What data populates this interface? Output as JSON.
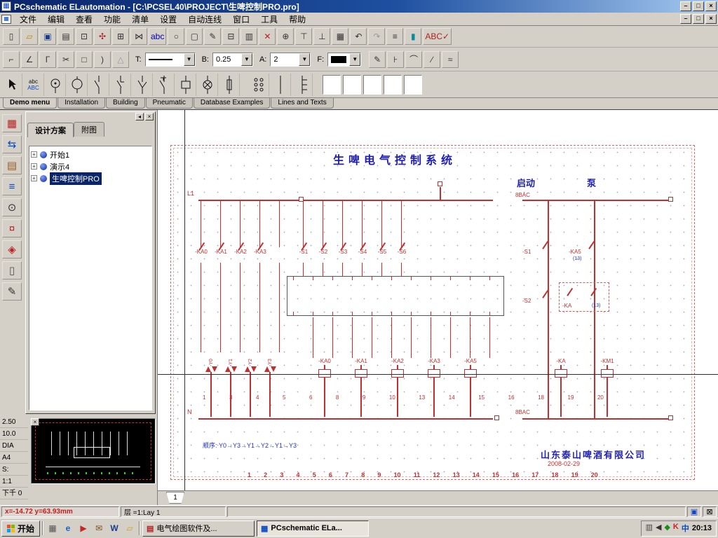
{
  "window": {
    "title": "PCschematic ELautomation - [C:\\PCSEL40\\PROJECT\\生啤控制PRO.pro]",
    "btn_min": "–",
    "btn_max": "□",
    "btn_close": "×"
  },
  "menu": {
    "items": [
      "文件",
      "编辑",
      "查看",
      "功能",
      "清单",
      "设置",
      "自动连线",
      "窗口",
      "工具",
      "帮助"
    ]
  },
  "toolbar_main": {
    "icons": [
      {
        "name": "new-icon",
        "glyph": "▯",
        "color": "#333333"
      },
      {
        "name": "open-icon",
        "glyph": "▱",
        "color": "#b8860b"
      },
      {
        "name": "save-icon",
        "glyph": "▣",
        "color": "#1a3a8a"
      },
      {
        "name": "print-icon",
        "glyph": "▤",
        "color": "#333333"
      },
      {
        "name": "print-preview-icon",
        "glyph": "⊡",
        "color": "#333333"
      },
      {
        "name": "object-groups-icon",
        "glyph": "✣",
        "color": "#b22222"
      },
      {
        "name": "pointer-grid-icon",
        "glyph": "⊞",
        "color": "#333333"
      },
      {
        "name": "symbols-icon",
        "glyph": "⋈",
        "color": "#333333"
      },
      {
        "name": "text-tool-icon",
        "glyph": "abc",
        "color": "#0000bb"
      },
      {
        "name": "circle-tool-icon",
        "glyph": "○",
        "color": "#333333"
      },
      {
        "name": "area-tool-icon",
        "glyph": "▢",
        "color": "#333333"
      },
      {
        "name": "pen-tool-icon",
        "glyph": "✎",
        "color": "#333333"
      },
      {
        "name": "paste-icon",
        "glyph": "⊟",
        "color": "#333333"
      },
      {
        "name": "copy-icon",
        "glyph": "▥",
        "color": "#333333"
      },
      {
        "name": "delete-icon",
        "glyph": "✕",
        "color": "#b22222"
      },
      {
        "name": "move-icon",
        "glyph": "⊕",
        "color": "#333333"
      },
      {
        "name": "reference-up-icon",
        "glyph": "⊤",
        "color": "#333333"
      },
      {
        "name": "reference-down-icon",
        "glyph": "⊥",
        "color": "#333333"
      },
      {
        "name": "net-grid-icon",
        "glyph": "▦",
        "color": "#333333"
      },
      {
        "name": "undo-icon",
        "glyph": "↶",
        "color": "#333333"
      },
      {
        "name": "redo-icon",
        "glyph": "↷",
        "color": "#999999"
      },
      {
        "name": "lists-icon",
        "glyph": "≡",
        "color": "#333333"
      },
      {
        "name": "manual-icon",
        "glyph": "▮",
        "color": "#0a8a9a"
      },
      {
        "name": "spellcheck-icon",
        "glyph": "ABC✓",
        "color": "#b22222"
      }
    ]
  },
  "toolbar_draw": {
    "left_icons": [
      {
        "name": "line-ortho-icon",
        "glyph": "⌐",
        "color": "#333333"
      },
      {
        "name": "line-angle-icon",
        "glyph": "∠",
        "color": "#333333"
      },
      {
        "name": "line-corner-icon",
        "glyph": "Γ",
        "color": "#333333"
      },
      {
        "name": "trim-icon",
        "glyph": "✂",
        "color": "#333333"
      },
      {
        "name": "rectangle-icon",
        "glyph": "□",
        "color": "#333333"
      },
      {
        "name": "arc-icon",
        "glyph": ")",
        "color": "#333333"
      },
      {
        "name": "ellipse-icon",
        "glyph": "△",
        "color": "#999999"
      }
    ],
    "t_label": "T:",
    "b_label": "B:",
    "b_value": "0.25",
    "a_label": "A:",
    "a_value": "2",
    "f_label": "F:",
    "right_icons": [
      {
        "name": "pen-icon",
        "glyph": "✎",
        "color": "#333333"
      },
      {
        "name": "junction-icon",
        "glyph": "⊦",
        "color": "#333333"
      },
      {
        "name": "arc-segment-icon",
        "glyph": "⌒",
        "color": "#333333"
      },
      {
        "name": "switch-line-icon",
        "glyph": "∕",
        "color": "#333333"
      },
      {
        "name": "wave-icon",
        "glyph": "≈",
        "color": "#333333"
      }
    ]
  },
  "symbolbar": {
    "abc_small": "abc",
    "abc_big": "ABC"
  },
  "page_tabs": {
    "items": [
      "Demo menu",
      "Installation",
      "Building",
      "Pneumatic",
      "Database Examples",
      "Lines and Texts"
    ]
  },
  "left_toolbar": {
    "icons": [
      {
        "name": "symbol-menu-icon",
        "glyph": "▦",
        "color": "#bb2222"
      },
      {
        "name": "router-icon",
        "glyph": "⇆",
        "color": "#0a4ac0"
      },
      {
        "name": "catalog-icon",
        "glyph": "▤",
        "color": "#9a5b20"
      },
      {
        "name": "object-lister-icon",
        "glyph": "≡",
        "color": "#0a4ac0"
      },
      {
        "name": "zoom-icon",
        "glyph": "⊙",
        "color": "#333333"
      },
      {
        "name": "pin-icon",
        "glyph": "¤",
        "color": "#bb2222"
      },
      {
        "name": "diamond-icon",
        "glyph": "◈",
        "color": "#bb2222"
      },
      {
        "name": "notes-icon",
        "glyph": "▯",
        "color": "#555555"
      },
      {
        "name": "edit-notes-icon",
        "glyph": "✎",
        "color": "#333333"
      }
    ]
  },
  "project_panel": {
    "tabs": [
      "设计方案",
      "附图"
    ],
    "tree": [
      "开始1",
      "演示4",
      "生啤控制PRO"
    ]
  },
  "left_values": [
    "2.50",
    "10.0",
    "DIA",
    "A4",
    "S:",
    "1:1",
    "下千 0"
  ],
  "canvas": {
    "title": "生啤电气控制系统",
    "start_label": "启动",
    "pump_label": "泵",
    "l1": "L1",
    "n": "N",
    "bac_top": "8BAC",
    "bac_bottom": "8BAC",
    "ka_contacts": [
      "-KA0",
      "-KA1",
      "-KA2",
      "-KA3"
    ],
    "switches": [
      "-S1",
      "-S2",
      "-S3",
      "-S4",
      "-S5",
      "-S6"
    ],
    "right_s1": "-S1",
    "right_s2": "-S2",
    "right_ka5": "-KA5",
    "ka_box": "-KA",
    "blue_note": "(13)",
    "valve_labels": [
      "-Y0",
      "-Y1",
      "-Y2",
      "-Y3"
    ],
    "coils_left": [
      "-KA0",
      "-KA1",
      "-KA2",
      "-KA3",
      "-KA5"
    ],
    "coils_right": [
      "-KA",
      "-KM1"
    ],
    "terminal_numbers": [
      "1",
      "3",
      "4",
      "5",
      "6",
      "8",
      "9",
      "10",
      "13",
      "14",
      "15",
      "16",
      "18",
      "19",
      "20"
    ],
    "column_numbers": [
      "1",
      "2",
      "3",
      "4",
      "5",
      "6",
      "7",
      "8",
      "9",
      "10",
      "11",
      "12",
      "13",
      "14",
      "15",
      "16",
      "17",
      "18",
      "19",
      "20"
    ],
    "sequence_note": "顺序: Y0→Y3→Y1→Y2→Y1→Y3",
    "company": "山东泰山啤酒有限公司",
    "date": "2008-02-29",
    "page_tab": "1"
  },
  "statusbar": {
    "coords": "x=-14.72 y=63.93mm",
    "layer": "层 =1:Lay 1"
  },
  "taskbar": {
    "start_label": "开始",
    "quick_launch": [
      {
        "name": "show-desktop-icon",
        "glyph": "▦",
        "color": "#555555"
      },
      {
        "name": "browser-icon",
        "glyph": "e",
        "color": "#1565c0"
      },
      {
        "name": "media-icon",
        "glyph": "▶",
        "color": "#c62828"
      },
      {
        "name": "mail-icon",
        "glyph": "✉",
        "color": "#7a4f1d"
      },
      {
        "name": "word-icon",
        "glyph": "W",
        "color": "#1a3c8f"
      },
      {
        "name": "folder-icon",
        "glyph": "▱",
        "color": "#c9a227"
      }
    ],
    "tasks": [
      {
        "name": "task-electrical-drawing",
        "label": "电气绘图软件及...",
        "glyph": "▤",
        "color": "#b22222"
      },
      {
        "name": "task-pcschematic",
        "label": "PCschematic ELa...",
        "glyph": "▦",
        "color": "#0a4ac0"
      }
    ],
    "tray_icons": [
      {
        "name": "graphics-tray-icon",
        "glyph": "▥",
        "color": "#444444"
      },
      {
        "name": "volume-icon",
        "glyph": "◀",
        "color": "#333333"
      },
      {
        "name": "antivirus-icon",
        "glyph": "◆",
        "color": "#1a8f1a"
      },
      {
        "name": "kingsoft-icon",
        "glyph": "K",
        "color": "#cc2222"
      },
      {
        "name": "ime-icon",
        "glyph": "中",
        "color": "#0a4ac0"
      }
    ],
    "clock": "20:13"
  }
}
